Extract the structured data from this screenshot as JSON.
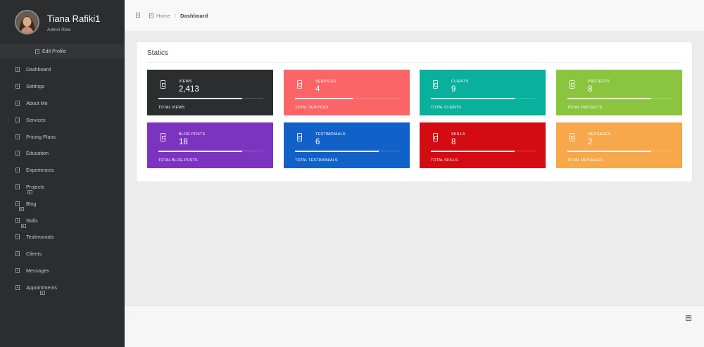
{
  "user": {
    "name": "Tiana Rafiki1",
    "role": "Admin Role"
  },
  "sidebar": {
    "edit_profile": "Edit Profile",
    "items": [
      {
        "label": "Dashboard"
      },
      {
        "label": "Settings"
      },
      {
        "label": "About Me"
      },
      {
        "label": "Services"
      },
      {
        "label": "Pricing Plans"
      },
      {
        "label": "Education"
      },
      {
        "label": "Experiences"
      },
      {
        "label": "Projects"
      },
      {
        "label": "Blog"
      },
      {
        "label": "Skills"
      },
      {
        "label": "Testimonials"
      },
      {
        "label": "Clients"
      },
      {
        "label": "Messages"
      },
      {
        "label": "Appointments"
      }
    ]
  },
  "breadcrumb": {
    "home": "Home",
    "separator": "/",
    "current": "Dashboard"
  },
  "panel": {
    "title": "Statics"
  },
  "stats": [
    {
      "label": "VIEWS",
      "value": "2,413",
      "footer": "TOTAL VIEWS",
      "color": "#2b2d2f",
      "progress": 0.8
    },
    {
      "label": "SERVICES",
      "value": "4",
      "footer": "TOTAL SERVICES",
      "color": "#fb6568",
      "progress": 0.55
    },
    {
      "label": "CLIENTS",
      "value": "9",
      "footer": "TOTAL CLIENTS",
      "color": "#09b09b",
      "progress": 0.8
    },
    {
      "label": "PROJECTS",
      "value": "8",
      "footer": "TOTAL PROJECTS",
      "color": "#8bc53f",
      "progress": 0.8
    },
    {
      "label": "BLOG POSTS",
      "value": "18",
      "footer": "TOTAL BLOG POSTS",
      "color": "#7b33c0",
      "progress": 0.8
    },
    {
      "label": "TESTIMONIALS",
      "value": "6",
      "footer": "TOTAL TESTIMONIALS",
      "color": "#1261c9",
      "progress": 0.8
    },
    {
      "label": "SKILLS",
      "value": "8",
      "footer": "TOTAL SKILLS",
      "color": "#d30b13",
      "progress": 0.8
    },
    {
      "label": "MESSAGES",
      "value": "2",
      "footer": "TOTAL MESSAGES",
      "color": "#f6a84a",
      "progress": 0.8
    }
  ],
  "footer": {
    "text": "."
  }
}
